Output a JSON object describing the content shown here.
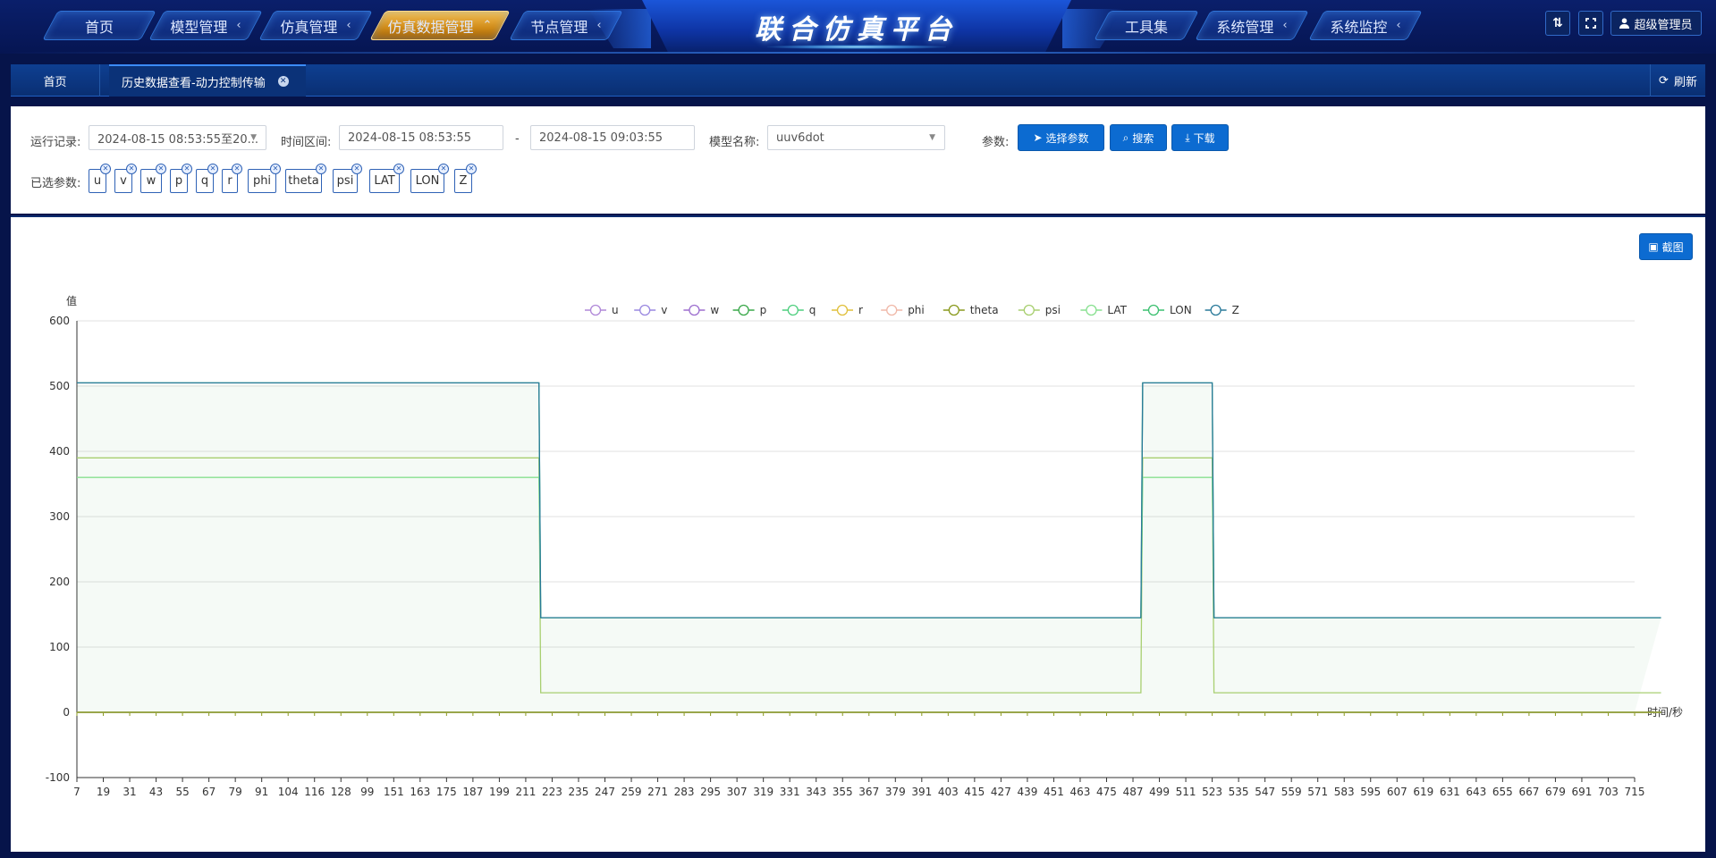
{
  "nav": {
    "left_tabs": [
      {
        "label": "首页",
        "chevron": ""
      },
      {
        "label": "模型管理",
        "chevron": "‹"
      },
      {
        "label": "仿真管理",
        "chevron": "‹"
      },
      {
        "label": "仿真数据管理",
        "chevron": "⌃"
      },
      {
        "label": "节点管理",
        "chevron": "‹"
      }
    ],
    "right_tabs": [
      {
        "label": "工具集",
        "chevron": ""
      },
      {
        "label": "系统管理",
        "chevron": "‹"
      },
      {
        "label": "系统监控",
        "chevron": "‹"
      }
    ],
    "title": "联合仿真平台",
    "user": "超级管理员",
    "active_tab": "仿真数据管理"
  },
  "tabs": {
    "home": "首页",
    "current": "历史数据查看-动力控制传输",
    "refresh": "刷新"
  },
  "filter": {
    "run_record_label": "运行记录:",
    "run_record_value": "2024-08-15 08:53:55至20...",
    "time_range_label": "时间区间:",
    "time_start": "2024-08-15 08:53:55",
    "time_sep": "-",
    "time_end": "2024-08-15 09:03:55",
    "model_label": "模型名称:",
    "model_value": "uuv6dot",
    "params_label": "参数:",
    "select_params_btn": "选择参数",
    "search_btn": "搜索",
    "download_btn": "下载",
    "selected_label": "已选参数:",
    "selected_params": [
      "u",
      "v",
      "w",
      "p",
      "q",
      "r",
      "phi",
      "theta",
      "psi",
      "LAT",
      "LON",
      "Z"
    ]
  },
  "chart_panel": {
    "screenshot_btn": "截图"
  },
  "colors": {
    "accent_blue": "#0c6bd1",
    "active_nav": "#f0a530",
    "nav_bg": "#0a1f6b"
  },
  "chart_data": {
    "type": "line",
    "ylabel": "值",
    "xlabel": "时间/秒",
    "ylim": [
      -100,
      600
    ],
    "yticks": [
      -100,
      0,
      100,
      200,
      300,
      400,
      500,
      600
    ],
    "grid": true,
    "legend_position": "top-center",
    "categories": [
      7,
      19,
      31,
      43,
      55,
      67,
      79,
      91,
      104,
      116,
      128,
      99,
      151,
      163,
      175,
      187,
      199,
      211,
      223,
      235,
      247,
      259,
      271,
      283,
      295,
      307,
      319,
      331,
      343,
      355,
      367,
      379,
      391,
      403,
      415,
      427,
      439,
      451,
      463,
      475,
      487,
      499,
      511,
      523,
      535,
      547,
      559,
      571,
      583,
      595,
      607,
      619,
      631,
      643,
      655,
      667,
      679,
      691,
      703,
      715
    ],
    "series": [
      {
        "name": "u",
        "color": "#b088d8",
        "segments": [
          [
            0,
            1,
            0
          ],
          [
            1,
            60,
            0
          ]
        ]
      },
      {
        "name": "v",
        "color": "#9a88e0",
        "segments": [
          [
            0,
            60,
            0
          ]
        ]
      },
      {
        "name": "w",
        "color": "#9d6fcf",
        "segments": [
          [
            0,
            60,
            0
          ]
        ]
      },
      {
        "name": "p",
        "color": "#3aa84a",
        "segments": [
          [
            0,
            60,
            0
          ]
        ]
      },
      {
        "name": "q",
        "color": "#4fcf7f",
        "segments": [
          [
            0,
            60,
            0
          ]
        ]
      },
      {
        "name": "r",
        "color": "#e0c03c",
        "segments": [
          [
            0,
            60,
            0
          ]
        ]
      },
      {
        "name": "phi",
        "color": "#f0b8a8",
        "segments": [
          [
            0,
            60,
            0
          ]
        ]
      },
      {
        "name": "theta",
        "color": "#8a9a1e",
        "segments": [
          [
            0,
            60,
            0
          ]
        ]
      },
      {
        "name": "psi",
        "color": "#a8cf70",
        "segments": [
          [
            0,
            17.5,
            390
          ],
          [
            17.5,
            40.3,
            30
          ],
          [
            40.3,
            43,
            390
          ],
          [
            43,
            60,
            30
          ]
        ]
      },
      {
        "name": "LAT",
        "color": "#88e090",
        "segments": [
          [
            0,
            17.5,
            360
          ],
          [
            17.5,
            40.3,
            145
          ],
          [
            40.3,
            43,
            360
          ],
          [
            43,
            60,
            145
          ]
        ]
      },
      {
        "name": "LON",
        "color": "#3cc070",
        "segments": [
          [
            0,
            17.5,
            505
          ],
          [
            17.5,
            40.3,
            145
          ],
          [
            40.3,
            43,
            505
          ],
          [
            43,
            60,
            145
          ]
        ]
      },
      {
        "name": "Z",
        "color": "#2a7a9a",
        "segments": [
          [
            0,
            17.5,
            505
          ],
          [
            17.5,
            40.3,
            145
          ],
          [
            40.3,
            43,
            505
          ],
          [
            43,
            60,
            145
          ]
        ]
      }
    ]
  }
}
